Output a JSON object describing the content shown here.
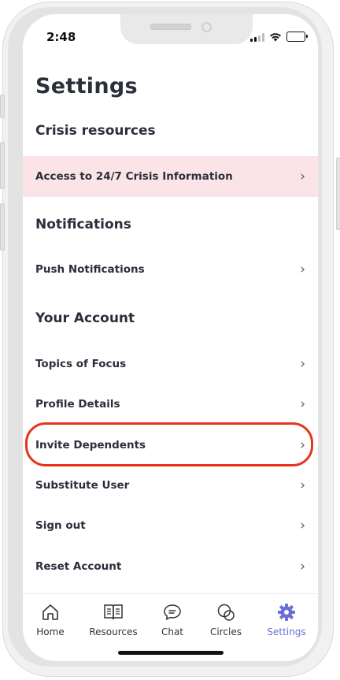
{
  "status": {
    "time": "2:48"
  },
  "page": {
    "title": "Settings"
  },
  "sections": {
    "crisis": "Crisis resources",
    "notifications": "Notifications",
    "account": "Your Account"
  },
  "rows": {
    "crisis_info": "Access to 24/7 Crisis Information",
    "push": "Push Notifications",
    "topics": "Topics of Focus",
    "profile": "Profile Details",
    "invite": "Invite Dependents",
    "substitute": "Substitute User",
    "signout": "Sign out",
    "reset": "Reset Account"
  },
  "chevron": "›",
  "tabs": [
    {
      "label": "Home",
      "icon": "home-icon"
    },
    {
      "label": "Resources",
      "icon": "book-icon"
    },
    {
      "label": "Chat",
      "icon": "chat-icon"
    },
    {
      "label": "Circles",
      "icon": "circles-icon"
    },
    {
      "label": "Settings",
      "icon": "gear-icon",
      "active": true
    }
  ],
  "colors": {
    "accent": "#6a6fd6",
    "crisis_row_bg": "#fbe4e8",
    "highlight": "#e8341c",
    "text": "#2b2f3a"
  }
}
